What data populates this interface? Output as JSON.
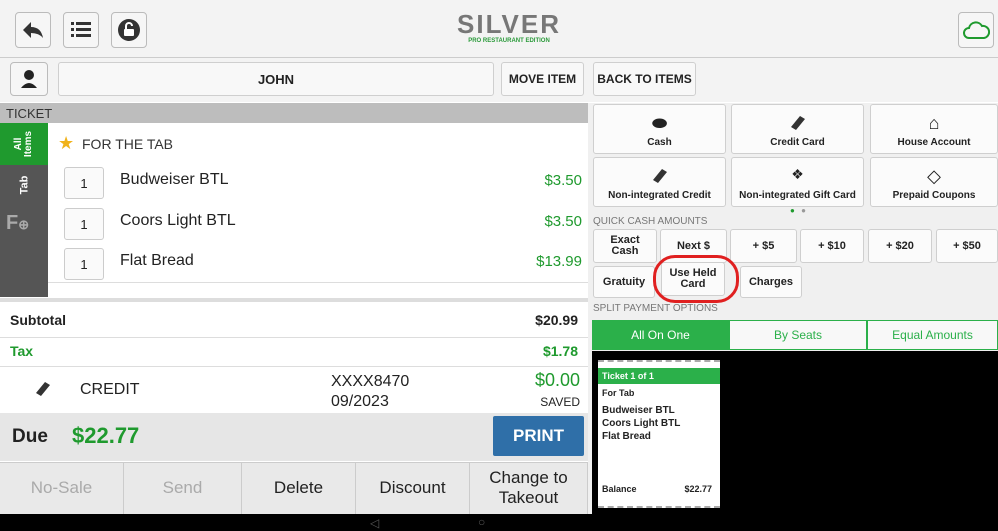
{
  "brand": {
    "name": "SILVER",
    "subtitle": "PRO RESTAURANT EDITION"
  },
  "customer": {
    "name": "JOHN"
  },
  "buttons": {
    "move_item": "MOVE ITEM",
    "back_to_items": "BACK TO ITEMS",
    "print": "PRINT"
  },
  "ticket": {
    "header": "TICKET",
    "side_tabs": [
      "All Items",
      "Tab"
    ],
    "group": "FOR THE TAB",
    "items": [
      {
        "qty": "1",
        "name": "Budweiser BTL",
        "price": "$3.50"
      },
      {
        "qty": "1",
        "name": "Coors Light BTL",
        "price": "$3.50"
      },
      {
        "qty": "1",
        "name": "Flat Bread",
        "price": "$13.99"
      }
    ]
  },
  "totals": {
    "subtotal_label": "Subtotal",
    "subtotal": "$20.99",
    "tax_label": "Tax",
    "tax": "$1.78",
    "due_label": "Due",
    "due": "$22.77"
  },
  "payment_line": {
    "type": "CREDIT",
    "card": "XXXX8470",
    "exp": "09/2023",
    "amount": "$0.00",
    "status": "SAVED"
  },
  "payment_methods": [
    {
      "label": "Cash",
      "icon": "cash-icon"
    },
    {
      "label": "Credit Card",
      "icon": "credit-card-icon"
    },
    {
      "label": "House Account",
      "icon": "house-icon"
    },
    {
      "label": "Non-integrated Credit",
      "icon": "credit-card-icon"
    },
    {
      "label": "Non-integrated Gift Card",
      "icon": "gift-card-icon"
    },
    {
      "label": "Prepaid Coupons",
      "icon": "coupon-icon"
    }
  ],
  "quick_cash": {
    "title": "QUICK CASH AMOUNTS",
    "amounts": [
      "Exact Cash",
      "Next $",
      "+ $5",
      "+ $10",
      "+ $20",
      "+ $50"
    ],
    "extras": [
      "Gratuity",
      "Use Held Card",
      "Charges"
    ]
  },
  "split": {
    "title": "SPLIT PAYMENT OPTIONS",
    "options": [
      "All On One",
      "By Seats",
      "Equal Amounts"
    ],
    "active": "All On One"
  },
  "receipt": {
    "header": "Ticket 1 of 1",
    "title": "For Tab",
    "items": [
      "Budweiser BTL",
      "Coors Light BTL",
      "Flat Bread"
    ],
    "balance_label": "Balance",
    "balance": "$22.77"
  },
  "bottom": [
    "No-Sale",
    "Send",
    "Delete",
    "Discount",
    "Change to Takeout"
  ],
  "colors": {
    "green": "#1f9a2e",
    "highlight": "#e02020",
    "print_blue": "#2f6fa8"
  }
}
